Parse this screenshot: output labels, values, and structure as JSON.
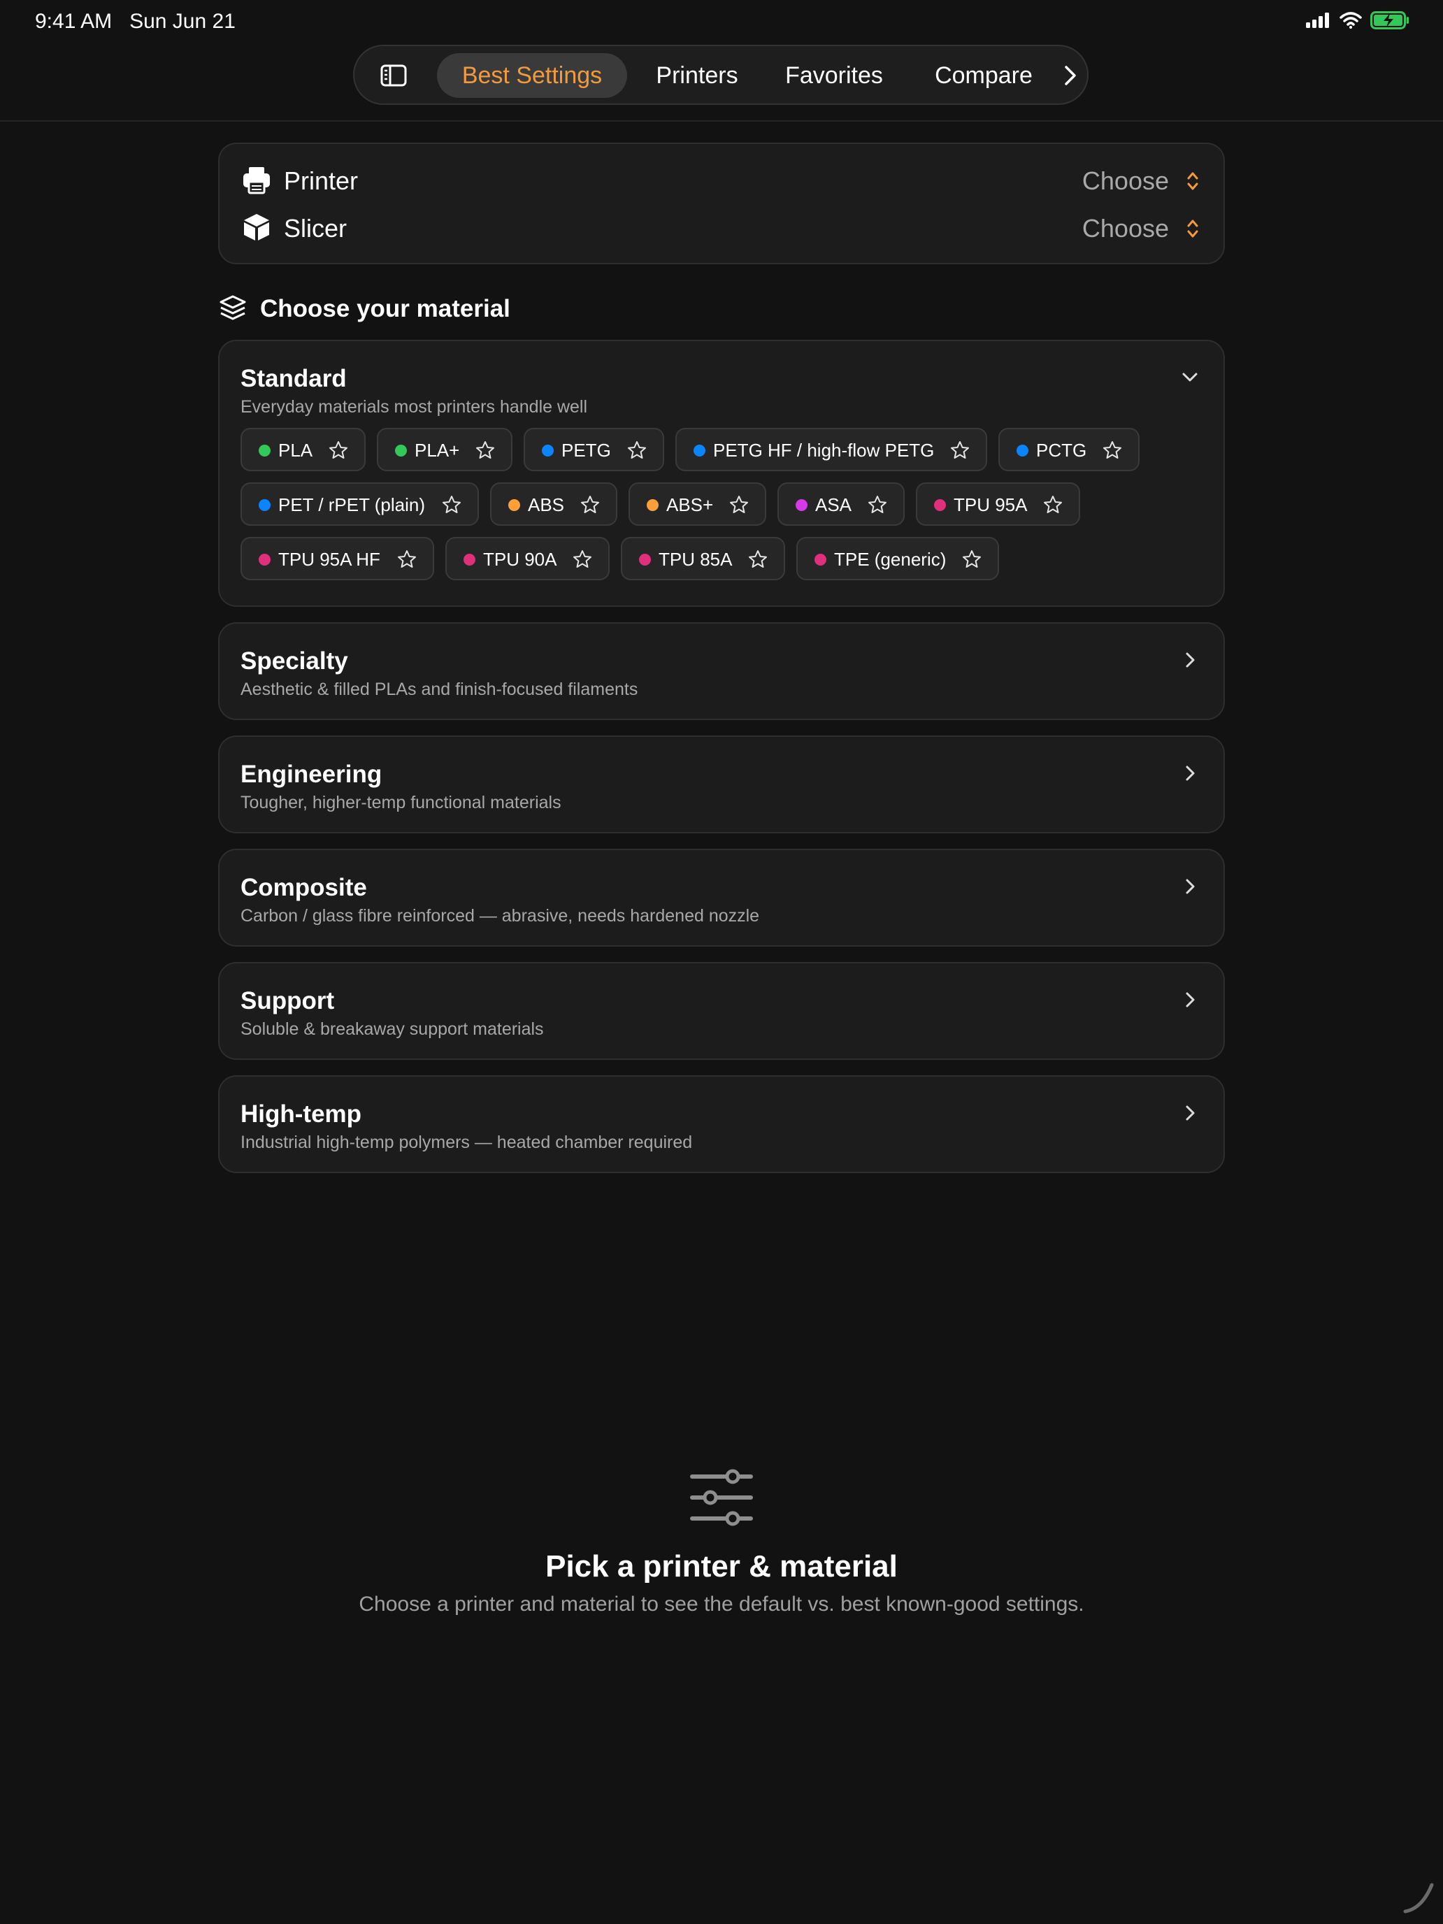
{
  "status_bar": {
    "time": "9:41 AM",
    "date": "Sun Jun 21"
  },
  "tabs": [
    {
      "label": "Best Settings",
      "active": true
    },
    {
      "label": "Printers",
      "active": false
    },
    {
      "label": "Favorites",
      "active": false
    },
    {
      "label": "Compare",
      "active": false
    }
  ],
  "setup": {
    "printer": {
      "label": "Printer",
      "value": "Choose"
    },
    "slicer": {
      "label": "Slicer",
      "value": "Choose"
    }
  },
  "material_heading": "Choose your material",
  "categories": [
    {
      "title": "Standard",
      "subtitle": "Everyday materials most printers handle well",
      "expanded": true,
      "materials": [
        {
          "name": "PLA",
          "color": "#34c759"
        },
        {
          "name": "PLA+",
          "color": "#34c759"
        },
        {
          "name": "PETG",
          "color": "#0a84ff"
        },
        {
          "name": "PETG HF / high-flow PETG",
          "color": "#0a84ff"
        },
        {
          "name": "PCTG",
          "color": "#0a84ff"
        },
        {
          "name": "PET / rPET (plain)",
          "color": "#0a84ff"
        },
        {
          "name": "ABS",
          "color": "#ff9f3a"
        },
        {
          "name": "ABS+",
          "color": "#ff9f3a"
        },
        {
          "name": "ASA",
          "color": "#d63ae6"
        },
        {
          "name": "TPU 95A",
          "color": "#e0307c"
        },
        {
          "name": "TPU 95A HF",
          "color": "#e0307c"
        },
        {
          "name": "TPU 90A",
          "color": "#e0307c"
        },
        {
          "name": "TPU 85A",
          "color": "#e0307c"
        },
        {
          "name": "TPE (generic)",
          "color": "#e0307c"
        }
      ]
    },
    {
      "title": "Specialty",
      "subtitle": "Aesthetic & filled PLAs and finish-focused filaments",
      "expanded": false
    },
    {
      "title": "Engineering",
      "subtitle": "Tougher, higher-temp functional materials",
      "expanded": false
    },
    {
      "title": "Composite",
      "subtitle": "Carbon / glass fibre reinforced — abrasive, needs hardened nozzle",
      "expanded": false
    },
    {
      "title": "Support",
      "subtitle": "Soluble & breakaway support materials",
      "expanded": false
    },
    {
      "title": "High-temp",
      "subtitle": "Industrial high-temp polymers — heated chamber required",
      "expanded": false
    }
  ],
  "empty_state": {
    "title": "Pick a printer & material",
    "subtitle": "Choose a printer and material to see the default vs. best known-good settings."
  },
  "colors": {
    "accent": "#f39a3d",
    "battery": "#34c759"
  }
}
